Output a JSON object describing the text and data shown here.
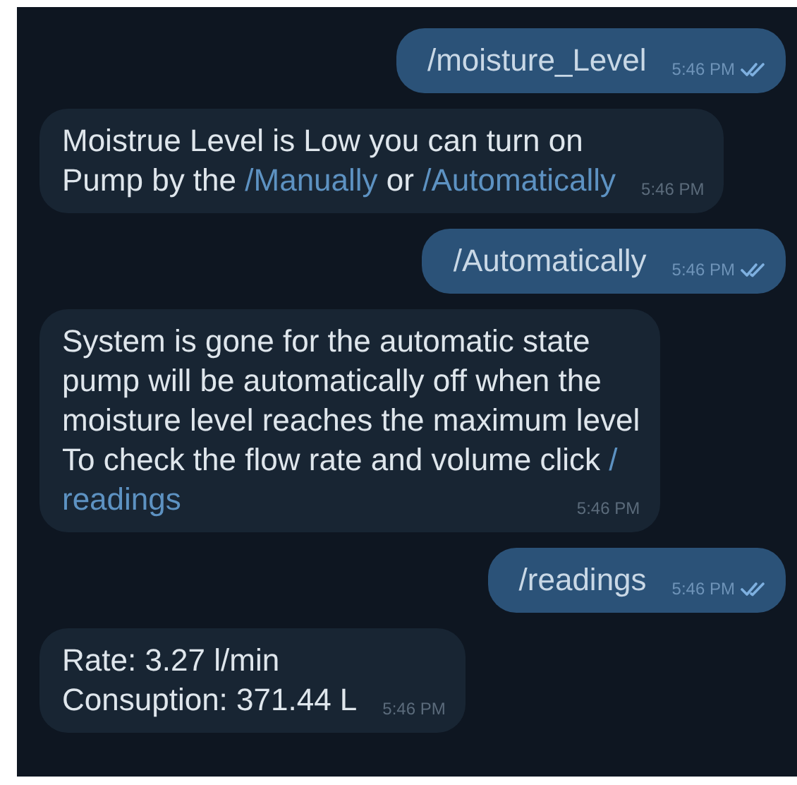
{
  "messages": [
    {
      "kind": "outgoing",
      "lines": [
        [
          {
            "kind": "text",
            "text": "/moisture_Level"
          }
        ]
      ],
      "time": "5:46 PM",
      "read": true
    },
    {
      "kind": "incoming",
      "lines": [
        [
          {
            "kind": "text",
            "text": "Moistrue Level is Low you can turn on"
          }
        ],
        [
          {
            "kind": "text",
            "text": "Pump by the "
          },
          {
            "kind": "command",
            "text": "/Manually"
          },
          {
            "kind": "text",
            "text": " or "
          },
          {
            "kind": "command",
            "text": "/Automatically"
          }
        ]
      ],
      "time": "5:46 PM"
    },
    {
      "kind": "outgoing",
      "lines": [
        [
          {
            "kind": "text",
            "text": "/Automatically"
          }
        ]
      ],
      "time": "5:46 PM",
      "read": true
    },
    {
      "kind": "incoming",
      "lines": [
        [
          {
            "kind": "text",
            "text": "System is gone for the automatic state"
          }
        ],
        [
          {
            "kind": "text",
            "text": "pump will be automatically off when the"
          }
        ],
        [
          {
            "kind": "text",
            "text": "moisture level reaches the maximum level"
          }
        ],
        [
          {
            "kind": "text",
            "text": "To check the flow rate and volume click "
          },
          {
            "kind": "command",
            "text": "/"
          }
        ],
        [
          {
            "kind": "command",
            "text": "readings"
          }
        ]
      ],
      "time": "5:46 PM"
    },
    {
      "kind": "outgoing",
      "lines": [
        [
          {
            "kind": "text",
            "text": "/readings"
          }
        ]
      ],
      "time": "5:46 PM",
      "read": true
    },
    {
      "kind": "incoming",
      "lines": [
        [
          {
            "kind": "text",
            "text": "Rate: 3.27 l/min"
          }
        ],
        [
          {
            "kind": "text",
            "text": "Consuption: 371.44 L"
          }
        ]
      ],
      "time": "5:46 PM"
    }
  ]
}
